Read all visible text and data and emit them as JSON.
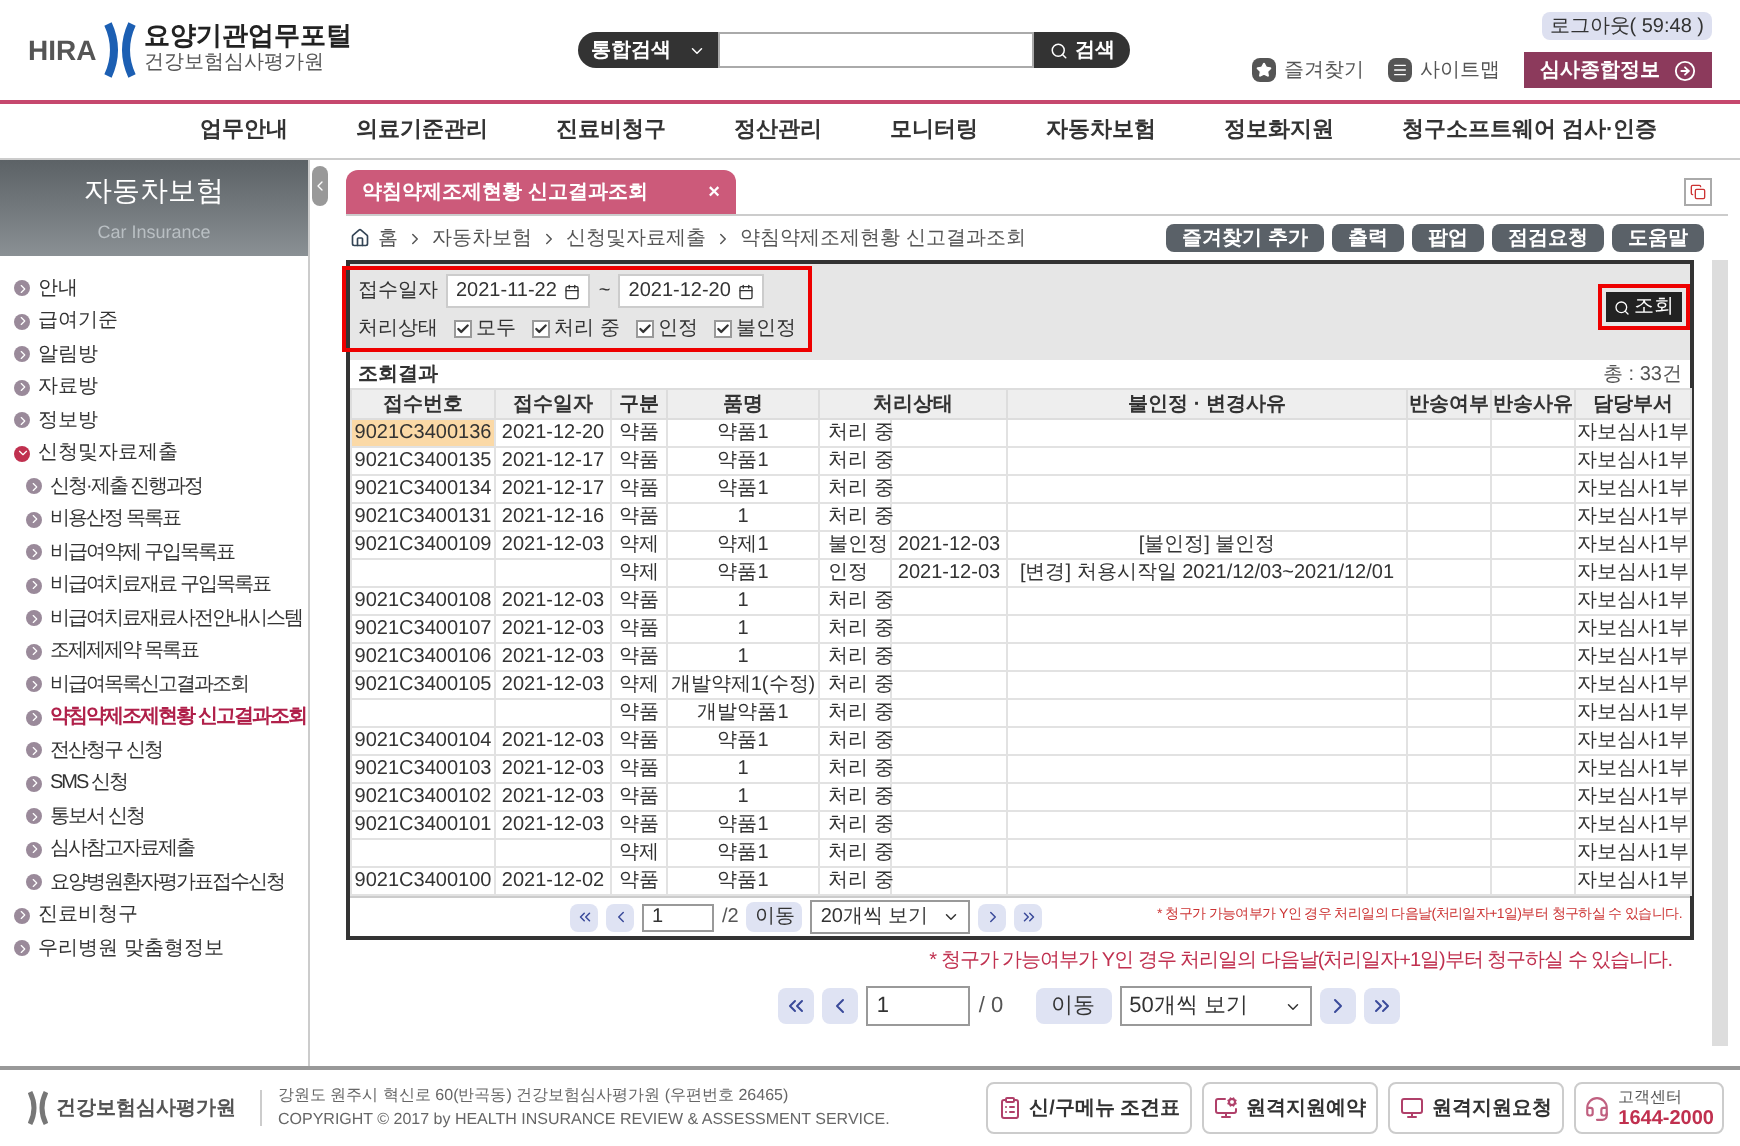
{
  "header": {
    "logo_mark": "HIRA",
    "portal_title": "요양기관업무포털",
    "org_name": "건강보험심사평가원",
    "search_scope": "통합검색",
    "search_button": "검색",
    "logout": "로그아웃( 59:48 )",
    "favorites": "즐겨찾기",
    "sitemap": "사이트맵",
    "review_info": "심사종합정보"
  },
  "nav": [
    "업무안내",
    "의료기준관리",
    "진료비청구",
    "정산관리",
    "모니터링",
    "자동차보험",
    "정보화지원",
    "청구소프트웨어 검사·인증"
  ],
  "sidebar": {
    "title": "자동차보험",
    "subtitle": "Car Insurance",
    "items": [
      {
        "label": "안내",
        "expanded": false
      },
      {
        "label": "급여기준",
        "expanded": false
      },
      {
        "label": "알림방",
        "expanded": false
      },
      {
        "label": "자료방",
        "expanded": false
      },
      {
        "label": "정보방",
        "expanded": false
      },
      {
        "label": "신청및자료제출",
        "expanded": true,
        "children": [
          {
            "label": "신청·제출 진행과정",
            "selected": false
          },
          {
            "label": "비용산정 목록표",
            "selected": false
          },
          {
            "label": "비급여약제 구입목록표",
            "selected": false
          },
          {
            "label": "비급여치료재료 구입목록표",
            "selected": false
          },
          {
            "label": "비급여치료재료사전안내시스템",
            "selected": false
          },
          {
            "label": "조제제제약 목록표",
            "selected": false
          },
          {
            "label": "비급여목록신고결과조회",
            "selected": false
          },
          {
            "label": "약침약제조제현황 신고결과조회",
            "selected": true
          },
          {
            "label": "전산청구 신청",
            "selected": false
          },
          {
            "label": "SMS 신청",
            "selected": false
          },
          {
            "label": "통보서 신청",
            "selected": false
          },
          {
            "label": "심사참고자료제출",
            "selected": false
          },
          {
            "label": "요양병원환자평가표접수신청",
            "selected": false
          }
        ]
      },
      {
        "label": "진료비청구",
        "expanded": false
      },
      {
        "label": "우리병원 맞춤형정보",
        "expanded": false
      }
    ]
  },
  "tab": {
    "label": "약침약제조제현황 신고결과조회",
    "close": "×"
  },
  "breadcrumb": [
    "홈",
    "자동차보험",
    "신청및자료제출",
    "약침약제조제현황 신고결과조회"
  ],
  "actions": [
    "즐겨찾기 추가",
    "출력",
    "팝업",
    "점검요청",
    "도움말"
  ],
  "screenshot": {
    "filter": {
      "date_label": "접수일자",
      "date_from": "2021-11-22",
      "date_separator": "~",
      "date_to": "2021-12-20",
      "status_label": "처리상태",
      "options": [
        {
          "label": "모두",
          "checked": true
        },
        {
          "label": "처리 중",
          "checked": true
        },
        {
          "label": "인정",
          "checked": true
        },
        {
          "label": "불인정",
          "checked": true
        }
      ],
      "search_button": "조회"
    },
    "result_title": "조회결과",
    "total": "총 : 33건",
    "columns": [
      "접수번호",
      "접수일자",
      "구분",
      "품명",
      "처리상태",
      "불인정 · 변경사유",
      "반송여부",
      "반송사유",
      "담당부서"
    ],
    "rows": [
      {
        "no": "9021C3400136",
        "date": "2021-12-20",
        "type": "약품",
        "name": "약품1",
        "status": "처리 중",
        "dept": "자보심사1부",
        "selected": true
      },
      {
        "no": "9021C3400135",
        "date": "2021-12-17",
        "type": "약품",
        "name": "약품1",
        "status": "처리 중",
        "dept": "자보심사1부",
        "selected": false
      },
      {
        "no": "9021C3400134",
        "date": "2021-12-17",
        "type": "약품",
        "name": "약품1",
        "status": "처리 중",
        "dept": "자보심사1부",
        "selected": false
      },
      {
        "no": "9021C3400131",
        "date": "2021-12-16",
        "type": "약품",
        "name": "1",
        "status": "처리 중",
        "dept": "자보심사1부",
        "selected": false
      },
      {
        "no": "9021C3400109",
        "date": "2021-12-03",
        "type": "약제",
        "name": "약제1",
        "status": "불인정",
        "status_date": "2021-12-03",
        "reason": "[불인정] 불인정",
        "dept": "자보심사1부",
        "selected": false
      },
      {
        "type": "약제",
        "name": "약품1",
        "status": "인정",
        "status_date": "2021-12-03",
        "reason": "[변경] 처용시작일 2021/12/03~2021/12/01",
        "dept": "자보심사1부",
        "selected": false
      },
      {
        "no": "9021C3400108",
        "date": "2021-12-03",
        "type": "약품",
        "name": "1",
        "status": "처리 중",
        "dept": "자보심사1부",
        "selected": false
      },
      {
        "no": "9021C3400107",
        "date": "2021-12-03",
        "type": "약품",
        "name": "1",
        "status": "처리 중",
        "dept": "자보심사1부",
        "selected": false
      },
      {
        "no": "9021C3400106",
        "date": "2021-12-03",
        "type": "약품",
        "name": "1",
        "status": "처리 중",
        "dept": "자보심사1부",
        "selected": false
      },
      {
        "no": "9021C3400105",
        "date": "2021-12-03",
        "type": "약제",
        "name": "개발약제1(수정)",
        "status": "처리 중",
        "dept": "자보심사1부",
        "selected": false
      },
      {
        "type": "약품",
        "name": "개발약품1",
        "status": "처리 중",
        "dept": "자보심사1부",
        "selected": false
      },
      {
        "no": "9021C3400104",
        "date": "2021-12-03",
        "type": "약품",
        "name": "약품1",
        "status": "처리 중",
        "dept": "자보심사1부",
        "selected": false
      },
      {
        "no": "9021C3400103",
        "date": "2021-12-03",
        "type": "약품",
        "name": "1",
        "status": "처리 중",
        "dept": "자보심사1부",
        "selected": false
      },
      {
        "no": "9021C3400102",
        "date": "2021-12-03",
        "type": "약품",
        "name": "1",
        "status": "처리 중",
        "dept": "자보심사1부",
        "selected": false
      },
      {
        "no": "9021C3400101",
        "date": "2021-12-03",
        "type": "약품",
        "name": "약품1",
        "status": "처리 중",
        "dept": "자보심사1부",
        "selected": false
      },
      {
        "type": "약제",
        "name": "약품1",
        "status": "처리 중",
        "dept": "자보심사1부",
        "selected": false
      },
      {
        "no": "9021C3400100",
        "date": "2021-12-02",
        "type": "약품",
        "name": "약품1",
        "status": "처리 중",
        "dept": "자보심사1부",
        "selected": false
      }
    ],
    "pager": {
      "page": "1",
      "total": "/2",
      "go": "이동",
      "size": "20개씩 보기"
    },
    "note": "* 청구가 가능여부가 Y인 경우 처리일의 다음날(처리일자+1일)부터 청구하실 수 있습니다."
  },
  "note": "* 청구가 가능여부가 Y인 경우 처리일의 다음날(처리일자+1일)부터 청구하실 수 있습니다.",
  "pager": {
    "page": "1",
    "total": "/ 0",
    "go": "이동",
    "size": "50개씩 보기"
  },
  "footer": {
    "logo_text": "건강보험심사평가원",
    "address": "강원도 원주시 혁신로 60(반곡동) 건강보험심사평가원  (우편번호 26465)",
    "copyright": "COPYRIGHT © 2017 by HEALTH INSURANCE REVIEW & ASSESSMENT SERVICE.",
    "buttons": [
      "신/구메뉴 조견표",
      "원격지원예약",
      "원격지원요청"
    ],
    "center_label": "고객센터",
    "center_phone": "1644-2000"
  }
}
